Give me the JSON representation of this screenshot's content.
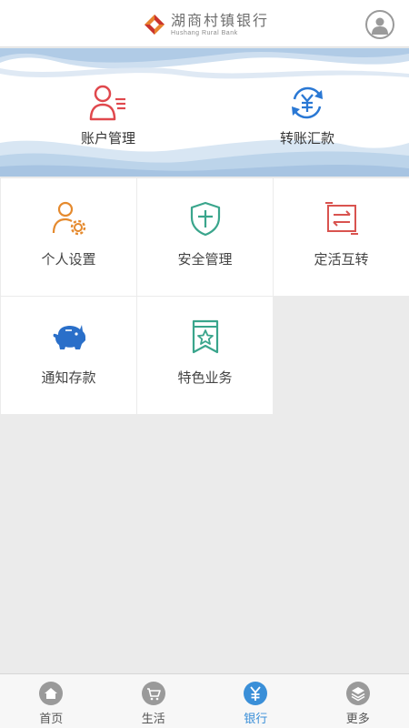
{
  "header": {
    "bank_name_cn": "湖商村镇银行",
    "bank_name_en": "Hushang Rural Bank",
    "logo_icon": "bank-logo-icon",
    "profile_icon": "user-profile-icon"
  },
  "banner": {
    "items": [
      {
        "label": "账户管理",
        "icon": "account-management-icon"
      },
      {
        "label": "转账汇款",
        "icon": "transfer-yuan-icon"
      }
    ]
  },
  "grid": {
    "items": [
      {
        "label": "个人设置",
        "icon": "personal-settings-icon"
      },
      {
        "label": "安全管理",
        "icon": "security-shield-icon"
      },
      {
        "label": "定活互转",
        "icon": "fixed-current-transfer-icon"
      },
      {
        "label": "通知存款",
        "icon": "piggy-bank-icon"
      },
      {
        "label": "特色业务",
        "icon": "featured-star-icon"
      }
    ]
  },
  "bottom_nav": {
    "items": [
      {
        "label": "首页",
        "icon": "home-icon",
        "active": false
      },
      {
        "label": "生活",
        "icon": "cart-icon",
        "active": false
      },
      {
        "label": "银行",
        "icon": "yuan-icon",
        "active": true
      },
      {
        "label": "更多",
        "icon": "layers-icon",
        "active": false
      }
    ]
  },
  "colors": {
    "account_red": "#e0484d",
    "transfer_blue": "#2a78d4",
    "settings_orange": "#e58a2e",
    "security_green": "#3aa58c",
    "fixed_red": "#d9534f",
    "piggy_blue": "#2a6fc9",
    "featured_green": "#3aa58c",
    "nav_active": "#3a8fd8",
    "nav_inactive": "#9a9a9a"
  }
}
